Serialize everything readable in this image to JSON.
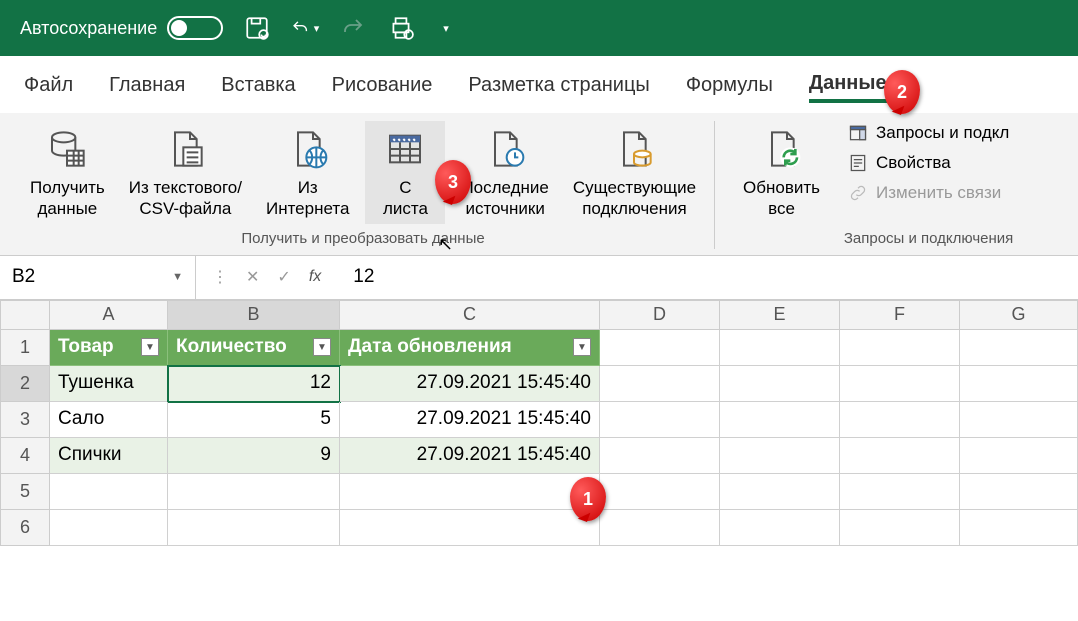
{
  "qat": {
    "autosave": "Автосохранение"
  },
  "tabs": [
    "Файл",
    "Главная",
    "Вставка",
    "Рисование",
    "Разметка страницы",
    "Формулы",
    "Данные"
  ],
  "active_tab": 6,
  "ribbon": {
    "btn_get_data": "Получить\nданные",
    "btn_from_csv": "Из текстового/\nCSV-файла",
    "btn_from_web": "Из\nИнтернета",
    "btn_from_sheet": "С\nлиста",
    "btn_recent": "Последние\nисточники",
    "btn_existing": "Существующие\nподключения",
    "group1_label": "Получить и преобразовать данные",
    "btn_refresh": "Обновить\nвсе",
    "side_queries": "Запросы и подкл",
    "side_properties": "Свойства",
    "side_edit_links": "Изменить связи",
    "group2_label": "Запросы и подключения"
  },
  "formula_bar": {
    "name": "B2",
    "value": "12"
  },
  "columns": [
    "A",
    "B",
    "C",
    "D",
    "E",
    "F",
    "G"
  ],
  "row_nums": [
    "1",
    "2",
    "3",
    "4",
    "5",
    "6"
  ],
  "table": {
    "headers": [
      "Товар",
      "Количество",
      "Дата обновления"
    ],
    "rows": [
      [
        "Тушенка",
        "12",
        "27.09.2021 15:45:40"
      ],
      [
        "Сало",
        "5",
        "27.09.2021 15:45:40"
      ],
      [
        "Спички",
        "9",
        "27.09.2021 15:45:40"
      ]
    ]
  },
  "balloons": {
    "b1": "1",
    "b2": "2",
    "b3": "3"
  }
}
